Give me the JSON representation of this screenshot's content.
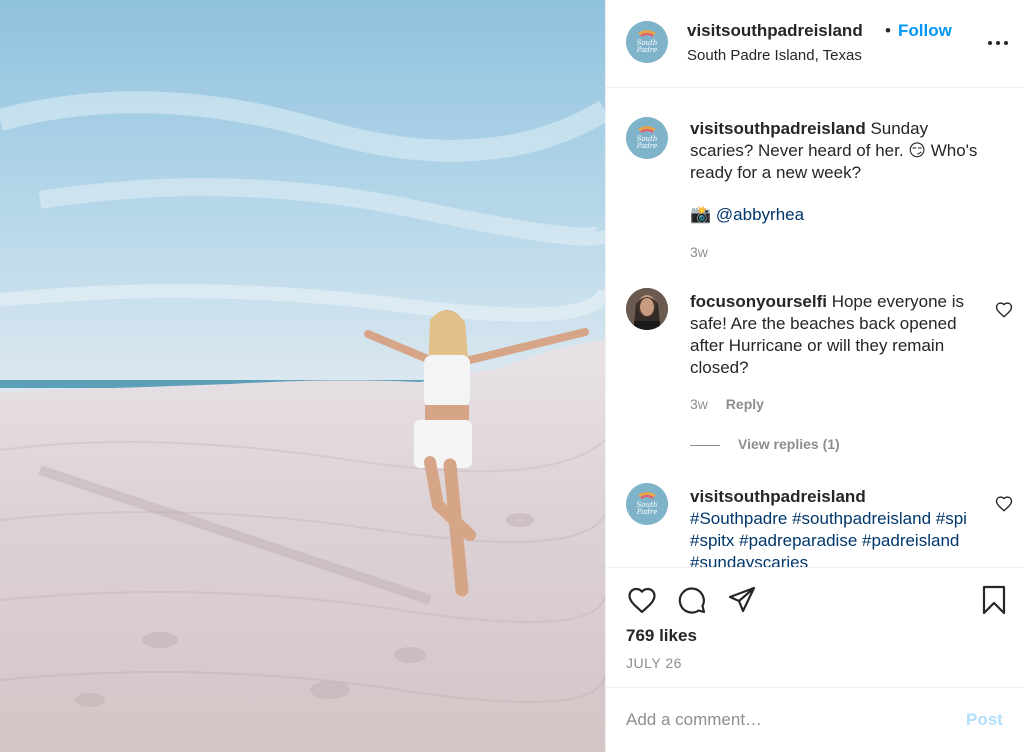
{
  "colors": {
    "accent": "#0095f6",
    "text": "#262626",
    "secondary": "#8e8e8e",
    "tag": "#00376b",
    "post_disabled": "#b2dffc",
    "border": "#efefef"
  },
  "post": {
    "image_alt": "Woman posing on white sand dunes at the beach"
  },
  "header": {
    "username": "visitsouthpadreisland",
    "separator": "•",
    "follow_label": "Follow",
    "location": "South Padre Island, Texas",
    "avatar_icon": "south-padre-logo-icon",
    "more_icon": "more-options-icon"
  },
  "comments": [
    {
      "username": "visitsouthpadreisland",
      "text": "Sunday scaries? Never heard of her. 😏 Who's ready for a new week?",
      "credit_emoji": "📸",
      "credit_tag": "@abbyrhea",
      "time": "3w"
    },
    {
      "username": "focusonyourselfi",
      "text": "Hope everyone is safe! Are the beaches back opened after Hurricane or will they remain closed?",
      "time": "3w",
      "reply_label": "Reply",
      "view_replies_label": "View replies (1)"
    },
    {
      "username": "visitsouthpadreisland",
      "hashtags": "#Southpadre #southpadreisland #spi #spitx #padreparadise #padreisland #sundayscaries"
    }
  ],
  "actions": {
    "like_icon": "heart-icon",
    "comment_icon": "comment-icon",
    "share_icon": "share-icon",
    "save_icon": "bookmark-icon",
    "likes_text": "769 likes",
    "date": "JULY 26"
  },
  "add_comment": {
    "placeholder": "Add a comment…",
    "post_label": "Post"
  }
}
